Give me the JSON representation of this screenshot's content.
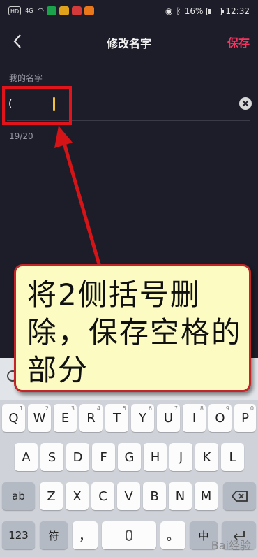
{
  "status_bar": {
    "left_chips": [
      "HD",
      "4G",
      "WiFi"
    ],
    "app_icons": [
      "app-icon-1",
      "app-icon-2",
      "app-icon-3",
      "app-icon-4"
    ],
    "battery": "16%",
    "time": "12:32",
    "icons": [
      "eye-icon",
      "bluetooth-icon",
      "battery-icon"
    ]
  },
  "nav": {
    "title": "修改名字",
    "save_label": "保存",
    "back_icon": "chevron-left-icon"
  },
  "form": {
    "label": "我的名字",
    "value": "(",
    "counter": "19/20",
    "clear_icon": "clear-icon"
  },
  "annotation": {
    "text": "将2侧括号删除，保存空格的部分"
  },
  "keyboard": {
    "row1": [
      "Q",
      "W",
      "E",
      "R",
      "T",
      "Y",
      "U",
      "I",
      "O",
      "P"
    ],
    "row2": [
      "A",
      "S",
      "D",
      "F",
      "G",
      "H",
      "J",
      "K",
      "L"
    ],
    "row3_letters": [
      "Z",
      "X",
      "C",
      "V",
      "B",
      "N",
      "M"
    ],
    "row3_fn_left": "ab",
    "row3_fn_right_icon": "backspace-icon",
    "row4": {
      "num": "123",
      "sym": "符",
      "comma": "，",
      "space": "",
      "period": "。",
      "lang": "中",
      "enter_icon": "enter-icon"
    },
    "hints": {
      "Q": "1",
      "W": "2",
      "E": "3",
      "R": "4",
      "T": "5",
      "Y": "6",
      "U": "7",
      "I": "8",
      "O": "9",
      "P": "0"
    },
    "watermark": "Bai经验"
  },
  "colors": {
    "accent": "#f5335f",
    "highlight": "#e0141a",
    "callout_bg": "#fcfcc2",
    "bg": "#1d1d29"
  }
}
